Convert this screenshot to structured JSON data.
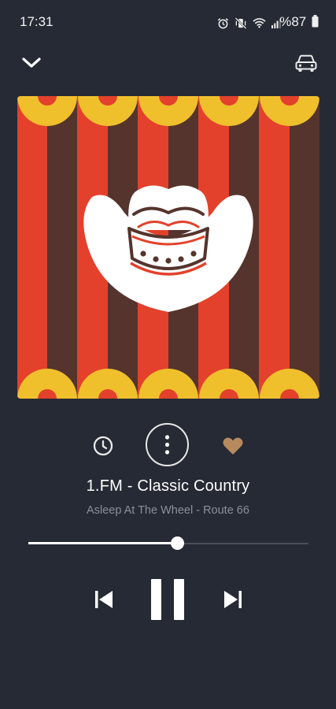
{
  "status_bar": {
    "time": "17:31",
    "battery": "%87",
    "icons": [
      "alarm-icon",
      "mute-vibrate-icon",
      "wifi-icon",
      "signal-icon",
      "battery-icon"
    ]
  },
  "header": {
    "collapse_icon": "chevron-down-icon",
    "car_mode_icon": "car-icon"
  },
  "artwork": {
    "subject": "cowboy-hat",
    "colors": {
      "red": "#e3412b",
      "brown": "#55342d",
      "yellow": "#f0c02c",
      "white": "#ffffff"
    }
  },
  "actions": {
    "timer_icon": "clock-icon",
    "more_icon": "more-vertical-icon",
    "favorite_icon": "heart-icon",
    "favorite_color": "#b78a5e"
  },
  "station": {
    "name": "1.FM - Classic Country",
    "now_playing": "Asleep At The Wheel - Route 66"
  },
  "playback": {
    "progress": 0.53,
    "state": "playing",
    "prev_icon": "skip-previous-icon",
    "pause_icon": "pause-icon",
    "next_icon": "skip-next-icon"
  },
  "colors": {
    "background": "#262a35",
    "secondary_text": "#8a8f99"
  }
}
